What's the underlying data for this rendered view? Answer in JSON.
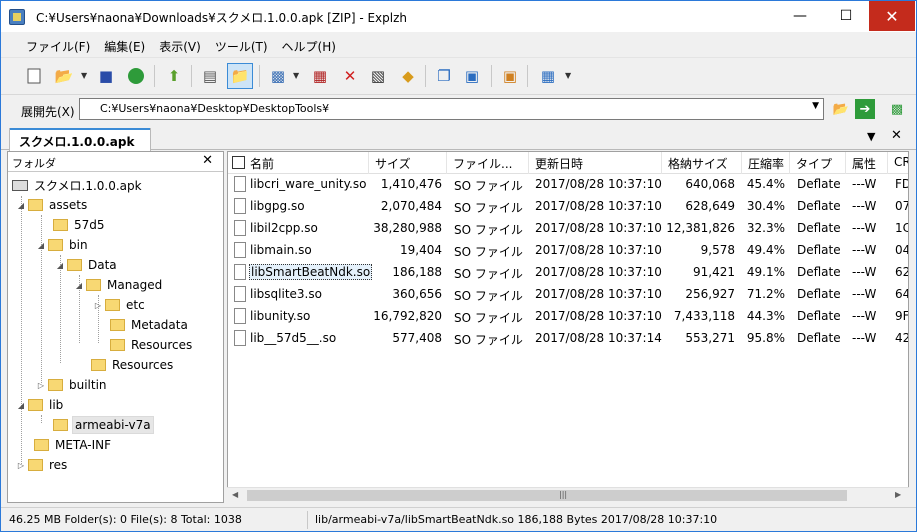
{
  "window": {
    "title": "C:¥Users¥naona¥Downloads¥スクメロ.1.0.0.apk [ZIP] - Explzh"
  },
  "menu": [
    "ファイル(F)",
    "編集(E)",
    "表示(V)",
    "ツール(T)",
    "ヘルプ(H)"
  ],
  "address": {
    "label": "展開先(X)",
    "value": "C:¥Users¥naona¥Desktop¥DesktopTools¥"
  },
  "tab": {
    "label": "スクメロ.1.0.0.apk"
  },
  "left_pane": {
    "header": "フォルダ",
    "tree": [
      {
        "label": "スクメロ.1.0.0.apk",
        "icon": "drive"
      },
      {
        "label": "assets"
      },
      {
        "label": "57d5"
      },
      {
        "label": "bin"
      },
      {
        "label": "Data"
      },
      {
        "label": "Managed"
      },
      {
        "label": "etc"
      },
      {
        "label": "Metadata"
      },
      {
        "label": "Resources"
      },
      {
        "label": "Resources"
      },
      {
        "label": "builtin"
      },
      {
        "label": "lib"
      },
      {
        "label": "armeabi-v7a",
        "selected": true
      },
      {
        "label": "META-INF"
      },
      {
        "label": "res"
      }
    ]
  },
  "file_list": {
    "columns": [
      "名前",
      "サイズ",
      "ファイル...",
      "更新日時",
      "格納サイズ",
      "圧縮率",
      "タイプ",
      "属性",
      "CR"
    ],
    "rows": [
      {
        "name": "libcri_ware_unity.so",
        "size": "1,410,476",
        "type": "SO ファイル",
        "date": "2017/08/28 10:37:10",
        "packed": "640,068",
        "ratio": "45.4%",
        "method": "Deflate",
        "attr": "---W",
        "crc": "FD"
      },
      {
        "name": "libgpg.so",
        "size": "2,070,484",
        "type": "SO ファイル",
        "date": "2017/08/28 10:37:10",
        "packed": "628,649",
        "ratio": "30.4%",
        "method": "Deflate",
        "attr": "---W",
        "crc": "07"
      },
      {
        "name": "libil2cpp.so",
        "size": "38,280,988",
        "type": "SO ファイル",
        "date": "2017/08/28 10:37:10",
        "packed": "12,381,826",
        "ratio": "32.3%",
        "method": "Deflate",
        "attr": "---W",
        "crc": "1C"
      },
      {
        "name": "libmain.so",
        "size": "19,404",
        "type": "SO ファイル",
        "date": "2017/08/28 10:37:10",
        "packed": "9,578",
        "ratio": "49.4%",
        "method": "Deflate",
        "attr": "---W",
        "crc": "04"
      },
      {
        "name": "libSmartBeatNdk.so",
        "size": "186,188",
        "type": "SO ファイル",
        "date": "2017/08/28 10:37:10",
        "packed": "91,421",
        "ratio": "49.1%",
        "method": "Deflate",
        "attr": "---W",
        "crc": "62"
      },
      {
        "name": "libsqlite3.so",
        "size": "360,656",
        "type": "SO ファイル",
        "date": "2017/08/28 10:37:10",
        "packed": "256,927",
        "ratio": "71.2%",
        "method": "Deflate",
        "attr": "---W",
        "crc": "64"
      },
      {
        "name": "libunity.so",
        "size": "16,792,820",
        "type": "SO ファイル",
        "date": "2017/08/28 10:37:10",
        "packed": "7,433,118",
        "ratio": "44.3%",
        "method": "Deflate",
        "attr": "---W",
        "crc": "9F"
      },
      {
        "name": "lib__57d5__.so",
        "size": "577,408",
        "type": "SO ファイル",
        "date": "2017/08/28 10:37:14",
        "packed": "553,271",
        "ratio": "95.8%",
        "method": "Deflate",
        "attr": "---W",
        "crc": "42"
      }
    ]
  },
  "status": {
    "left": "46.25 MB  Folder(s): 0  File(s): 8  Total: 1038",
    "right": "lib/armeabi-v7a/libSmartBeatNdk.so  186,188 Bytes  2017/08/28 10:37:10"
  }
}
